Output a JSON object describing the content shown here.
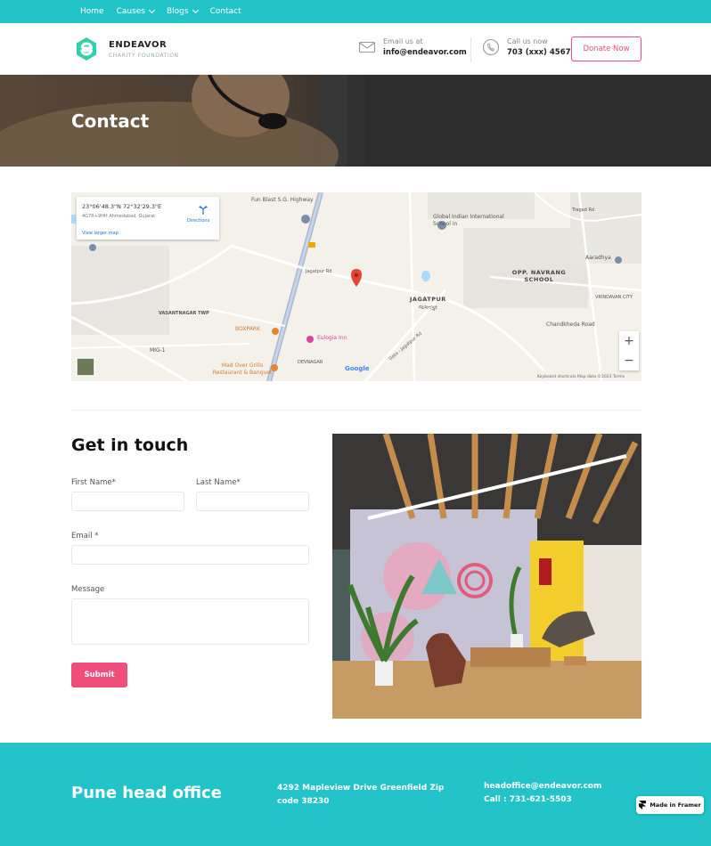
{
  "nav": {
    "items": [
      {
        "label": "Home",
        "has_dropdown": false
      },
      {
        "label": "Causes",
        "has_dropdown": true
      },
      {
        "label": "Blogs",
        "has_dropdown": true
      },
      {
        "label": "Contact",
        "has_dropdown": false
      }
    ]
  },
  "header": {
    "brand_name": "ENDEAVOR",
    "brand_sub": "CHARITY FOUNDATION",
    "email_label": "Email us at",
    "email_value": "info@endeavor.com",
    "call_label": "Call us now",
    "call_value": "703 (xxx) 4567",
    "donate_label": "Donate Now"
  },
  "hero": {
    "title": "Contact"
  },
  "map": {
    "coords": "23°06'48.3\"N 72°32'29.3\"E",
    "address": "4G7R+9HH Ahmedabad, Gujarat",
    "directions_label": "Directions",
    "larger_map_label": "View larger map",
    "places": {
      "fun_blast": "Fun Blast S.G. Highway",
      "global_indian": "Global Indian International School in",
      "opp_navrang": "OPP. NAVRANG SCHOOL",
      "jagatpur": "JAGATPUR",
      "jagatpur_gu": "જગતપુર",
      "vasantnagar": "VASANTNAGAR TWP",
      "boxpark": "BOXPARK",
      "eulogia": "Eulogia Inn",
      "mad_over_grills": "Mad Over Grills Restaurant & Banquet",
      "devnagar": "DEVNAGAR",
      "chandkheda": "Chandkheda Road",
      "vrindavan": "VRINDAVAN CITY",
      "jagatpur_rd": "Jagatpur Rd",
      "mig": "MIG-1",
      "tragad": "Tragad Rd",
      "aaradhya": "Aaradhya",
      "gota": "Gota - Jagatpur Rd"
    },
    "footer_text": "Keyboard shortcuts   Map data ©2023   Terms",
    "google_label": "Google",
    "zoom_in": "+",
    "zoom_out": "−"
  },
  "form": {
    "title": "Get in touch",
    "first_name_label": "First Name*",
    "last_name_label": "Last Name*",
    "email_label": "Email *",
    "message_label": "Message",
    "submit_label": "Submit"
  },
  "footer": {
    "title": "Pune head office",
    "address": "4292 Mapleview Drive Greenfield Zip code 38230",
    "email": "headoffice@endeavor.com",
    "call": "Call :  731-621-5503"
  },
  "badge": {
    "label": "Made in Framer"
  },
  "colors": {
    "teal": "#23c4c9",
    "pink": "#ef4d7a",
    "logo_green": "#2fd1a6"
  },
  "icons": [
    "mail-icon",
    "phone-icon",
    "map-pin-icon",
    "framer-icon",
    "directions-icon"
  ]
}
